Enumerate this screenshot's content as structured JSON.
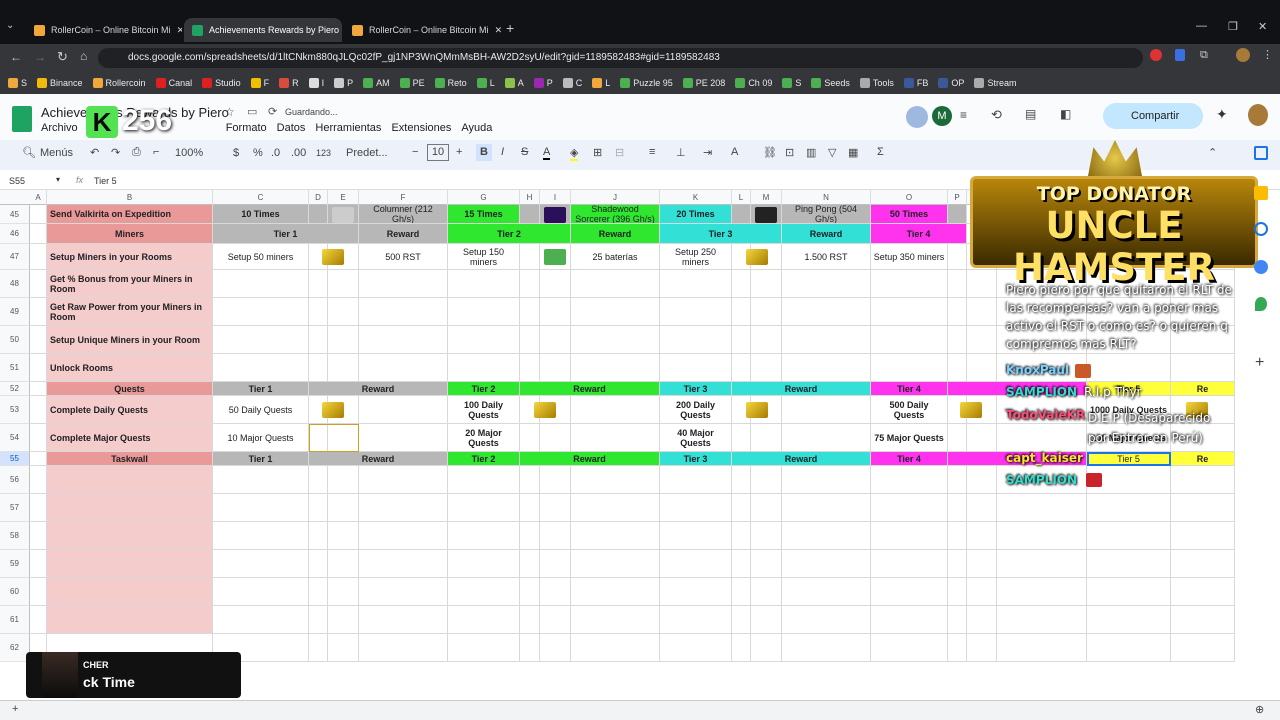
{
  "browser": {
    "tabs": [
      {
        "label": "RollerCoin – Online Bitcoin Mi",
        "active": false
      },
      {
        "label": "Achievements Rewards by Piero",
        "active": true
      },
      {
        "label": "RollerCoin – Online Bitcoin Mi",
        "active": false
      }
    ],
    "url": "docs.google.com/spreadsheets/d/1ltCNkm880qJLQc02fP_gj1NP3WnQMmMsBH-AW2D2syU/edit?gid=1189582483#gid=1189582483",
    "bookmarks": [
      "S",
      "Binance",
      "Rollercoin",
      "Canal",
      "Studio",
      "F",
      "R",
      "I",
      "P",
      "AM",
      "PE",
      "Reto",
      "L",
      "A",
      "P",
      "C",
      "L",
      "Puzzle 95",
      "PE 208",
      "Ch 09",
      "S",
      "Seeds",
      "Tools",
      "FB",
      "OP",
      "Stream"
    ]
  },
  "sheets": {
    "doc_title": "Achievements Rewards by Piero",
    "saving_status": "Guardando...",
    "menu": [
      "Archivo",
      "Formato",
      "Datos",
      "Herramientas",
      "Extensiones",
      "Ayuda"
    ],
    "share_label": "Compartir",
    "avatar_letter": "M",
    "toolbar": {
      "search_label": "Menús",
      "zoom": "100%",
      "currency": "$",
      "percent": "%",
      "dec_minus": ".0",
      "dec_plus": ".00",
      "numfmt": "123",
      "font": "Predet...",
      "font_size": "10"
    },
    "name_box": "S55",
    "formula": "Tier 5"
  },
  "grid": {
    "columns": [
      "A",
      "B",
      "C",
      "D",
      "E",
      "F",
      "G",
      "H",
      "I",
      "J",
      "K",
      "L",
      "M",
      "N",
      "O",
      "P"
    ],
    "rows": [
      "45",
      "46",
      "47",
      "48",
      "49",
      "50",
      "51",
      "52",
      "53",
      "54",
      "55",
      "56",
      "57",
      "58",
      "59",
      "60",
      "61",
      "62"
    ],
    "r45": {
      "b": "Send Valkirita on Expedition",
      "c": "10 Times",
      "f": "Columner (212 Gh/s)",
      "g": "15 Times",
      "j": "Shadewood Sorcerer (396 Gh/s)",
      "k": "20 Times",
      "n": "Ping Pong (504 Gh/s)",
      "o": "50 Times"
    },
    "r46": {
      "b": "Miners",
      "c": "Tier 1",
      "f": "Reward",
      "g": "Tier 2",
      "j": "Reward",
      "k": "Tier 3",
      "n": "Reward",
      "o": "Tier 4"
    },
    "r47": {
      "b": "Setup Miners in your Rooms",
      "c": "Setup 50 miners",
      "f": "500 RST",
      "g": "Setup 150 miners",
      "j": "25 baterías",
      "k": "Setup 250 miners",
      "n": "1.500 RST",
      "o": "Setup 350 miners"
    },
    "r48": {
      "b": "Get % Bonus from your Miners in Room"
    },
    "r49": {
      "b": "Get Raw Power from your Miners in Room"
    },
    "r50": {
      "b": "Setup Unique Miners in your Room"
    },
    "r51": {
      "b": "Unlock Rooms"
    },
    "r52": {
      "b": "Quests",
      "c": "Tier 1",
      "f": "Reward",
      "g": "Tier 2",
      "j": "Reward",
      "k": "Tier 3",
      "n": "Reward",
      "o": "Tier 4",
      "t5": "Tier 5",
      "re": "Re"
    },
    "r53": {
      "b": "Complete Daily Quests",
      "c": "50 Daily Quests",
      "g": "100 Daily Quests",
      "k": "200 Daily Quests",
      "o": "500 Daily Quests",
      "t5": "1000 Daily Quests"
    },
    "r54": {
      "b": "Complete Major Quests",
      "c": "10 Major Quests",
      "g": "20 Major Quests",
      "k": "40 Major Quests",
      "o": "75 Major Quests",
      "t5": "100 Major Quests"
    },
    "r55": {
      "b": "Taskwall",
      "c": "Tier 1",
      "f": "Reward",
      "g": "Tier 2",
      "j": "Reward",
      "k": "Tier 3",
      "n": "Reward",
      "o": "Tier 4",
      "t5": "Tier 5",
      "re": "Re"
    }
  },
  "overlay": {
    "banner_top": "TOP DONATOR",
    "banner_name": "UNCLE HAMSTER",
    "k_badge": "256",
    "chat": [
      {
        "user": "",
        "text": "Piero piero por que quitaron el RLT de las recompensas? van a poner mas activo el RST o como es? o quieren q compremos mas RLT?"
      },
      {
        "user": "KnoxPaul",
        "text": ""
      },
      {
        "user": "SAMPLION",
        "text": "R.I.p Thyr"
      },
      {
        "user": "TodoValeKR",
        "text": "D.E.P (Desaparecido por Entrar en Perú)"
      },
      {
        "user": "capt_kaiser",
        "text": ""
      },
      {
        "user": "SAMPLION",
        "text": ""
      }
    ],
    "music_artist": "CHER",
    "music_song": "ck Time"
  }
}
